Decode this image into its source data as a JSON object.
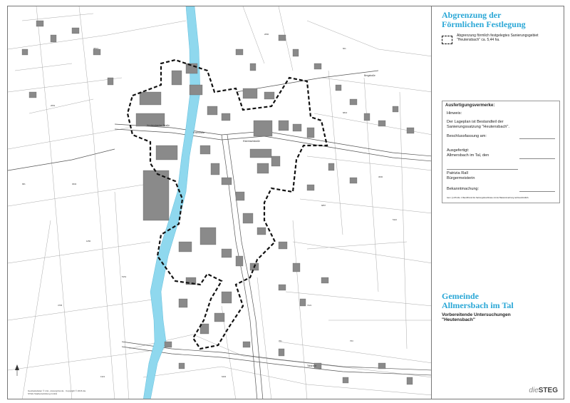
{
  "legend": {
    "title_line1": "Abgrenzung der",
    "title_line2": "Förmlichen Festlegung",
    "item_text": "Abgrenzung förmlich festgelegtes Sanierungsgebiet \"Heutensbach\" ca. 5,44 ha.",
    "swatch_icon": "dashed-boundary-icon"
  },
  "vermerke": {
    "heading": "Ausfertigungsvermerke:",
    "hinweis": "Hinweis:",
    "hinweis_text_1": "Der Lageplan ist Bestandteil der",
    "hinweis_text_2": "Sanierungssatzung \"Heutensbach\".",
    "beschluss": "Beschlussfassung am:",
    "ausgefertigt": "Ausgefertigt:",
    "ort": "Allmersbach im Tal, den",
    "name": "Patrizia Rall",
    "funktion": "Bürgermeisterin",
    "bekanntmachung": "Bekanntmachung:",
    "footnote": "Gem. § 215 Abs. 1 BauGB sind die Satzungsbeschlüsse mit der Bekanntmachung rechtsverbindlich."
  },
  "gemeinde": {
    "line1": "Gemeinde",
    "line2": "Allmersbach im Tal"
  },
  "vorbereitend": {
    "line1": "Vorbereitende Untersuchungen",
    "line2": "\"Heutensbach\""
  },
  "logo": {
    "prefix": "die",
    "name": "STEG"
  },
  "map": {
    "street_labels": [
      "Heutensbacher Straße",
      "Eisenbachstraße",
      "Bergstraße",
      "Kirchstraße",
      "Talstraße"
    ],
    "parcel_numbers": [
      "380/1",
      "2052",
      "6810",
      "3000",
      "6857",
      "1250",
      "4705",
      "5151",
      "701",
      "763",
      "681",
      "3004",
      "7221",
      "5110",
      "6402",
      "1321",
      "601",
      "2060"
    ],
    "colors": {
      "building": "#8a8a8a",
      "water": "#8fd8ee",
      "boundary": "#111111",
      "parcel_line": "#9a9a9a"
    }
  },
  "north_icon": "north-arrow-icon"
}
